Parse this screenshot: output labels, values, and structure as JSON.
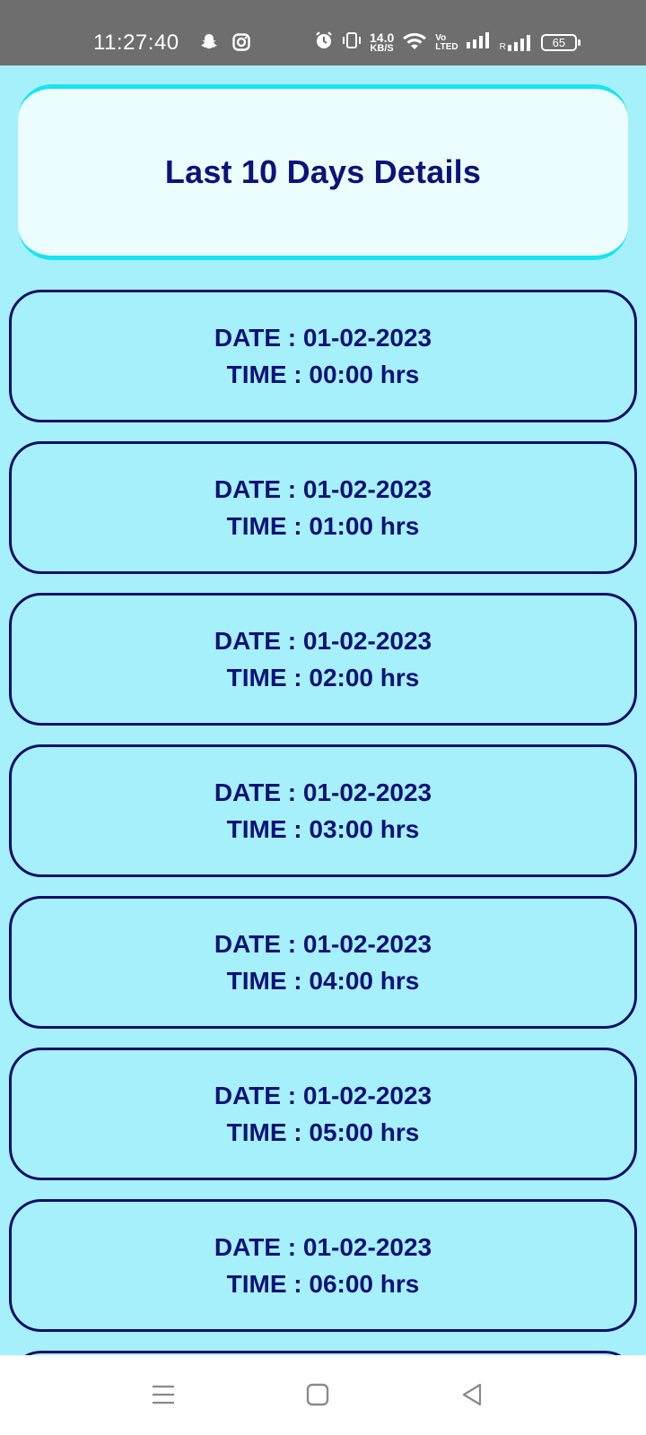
{
  "status_bar": {
    "time": "11:27:40",
    "net_speed_value": "14.0",
    "net_speed_unit": "KB/S",
    "volte_top": "Vo",
    "volte_bottom": "LTE",
    "volte_sub": "D",
    "roaming_label": "R",
    "battery": "65",
    "icons": [
      "snapchat-icon",
      "instagram-icon",
      "alarm-icon",
      "vibrate-icon",
      "wifi-icon",
      "signal-icon",
      "signal-roaming-icon",
      "battery-icon"
    ]
  },
  "header": {
    "title": "Last 10 Days Details"
  },
  "entries": [
    {
      "date": "DATE : 01-02-2023",
      "time": "TIME : 00:00 hrs"
    },
    {
      "date": "DATE : 01-02-2023",
      "time": "TIME : 01:00 hrs"
    },
    {
      "date": "DATE : 01-02-2023",
      "time": "TIME : 02:00 hrs"
    },
    {
      "date": "DATE : 01-02-2023",
      "time": "TIME : 03:00 hrs"
    },
    {
      "date": "DATE : 01-02-2023",
      "time": "TIME : 04:00 hrs"
    },
    {
      "date": "DATE : 01-02-2023",
      "time": "TIME : 05:00 hrs"
    },
    {
      "date": "DATE : 01-02-2023",
      "time": "TIME : 06:00 hrs"
    },
    {
      "date": "",
      "time": ""
    }
  ],
  "nav_bar": {
    "icons": [
      "menu-icon",
      "home-square-icon",
      "back-triangle-icon"
    ]
  },
  "colors": {
    "background": "#a6f0fb",
    "text_primary": "#0c1279",
    "header_accent": "#19e4f1",
    "status_bar": "#6e6e6e"
  }
}
